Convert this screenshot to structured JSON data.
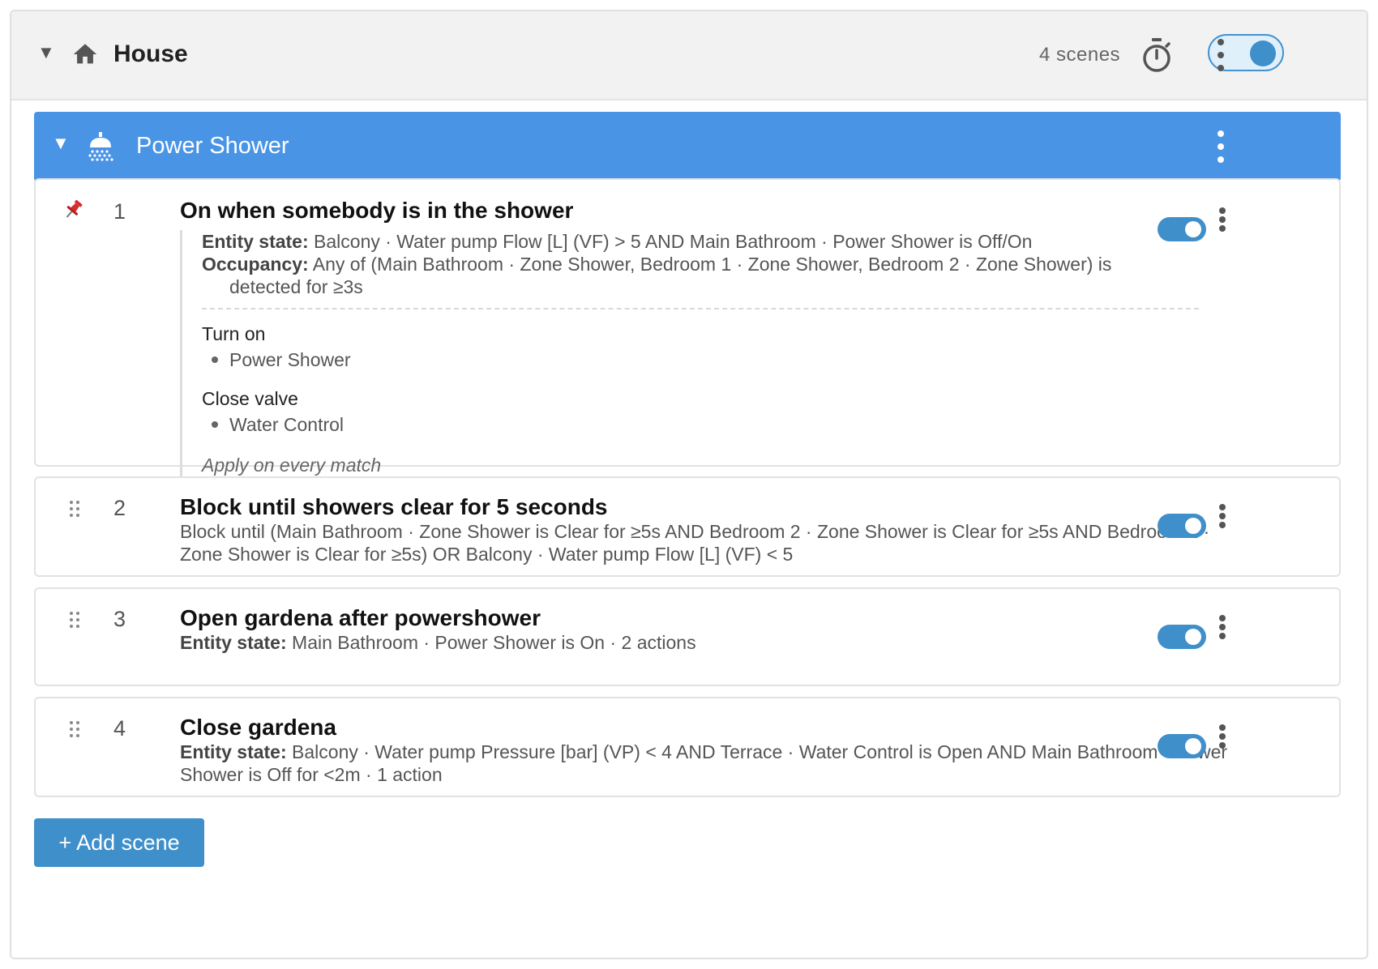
{
  "house": {
    "title": "House",
    "scene_count": "4 scenes",
    "enabled": true
  },
  "group": {
    "title": "Power Shower"
  },
  "scenes": [
    {
      "number": "1",
      "title": "On when somebody is in the shower",
      "enabled": true,
      "pinned": true,
      "conditions": [
        {
          "label": "Entity state:",
          "text": " Balcony · Water pump Flow [L] (VF) > 5 AND Main Bathroom · Power Shower is Off/On"
        },
        {
          "label": "Occupancy:",
          "text": " Any of (Main Bathroom · Zone Shower, Bedroom 1 · Zone Shower, Bedroom 2 · Zone Shower) is",
          "continuation": "detected for ≥3s"
        }
      ],
      "actions": [
        {
          "title": "Turn on",
          "items": [
            "Power Shower"
          ]
        },
        {
          "title": "Close valve",
          "items": [
            "Water Control"
          ]
        }
      ],
      "apply_mode": "Apply on every match"
    },
    {
      "number": "2",
      "title": "Block until showers clear for 5 seconds",
      "enabled": true,
      "description": "Block until (Main Bathroom · Zone Shower is Clear for ≥5s AND Bedroom 2 · Zone Shower is Clear for ≥5s AND Bedroom 1 · Zone Shower is Clear for ≥5s) OR Balcony · Water pump Flow [L] (VF) < 5"
    },
    {
      "number": "3",
      "title": "Open gardena after powershower",
      "enabled": true,
      "label": "Entity state:",
      "description": " Main Bathroom · Power Shower is On · 2 actions"
    },
    {
      "number": "4",
      "title": "Close gardena",
      "enabled": true,
      "label": "Entity state:",
      "description": " Balcony · Water pump Pressure [bar] (VP) < 4 AND Terrace · Water Control is Open AND Main Bathroom · Power Shower is Off for <2m · 1 action"
    }
  ],
  "add_button": "+ Add scene",
  "icons": {
    "expand": "caret-down-icon",
    "house": "home-icon",
    "timer": "timer-icon",
    "group": "shower-icon",
    "pin": "pin-icon",
    "drag": "drag-handle-icon",
    "menu": "more-vertical-icon"
  },
  "colors": {
    "accent": "#3f8fca",
    "group_header": "#4a94e6",
    "pin": "#d32f2f"
  }
}
